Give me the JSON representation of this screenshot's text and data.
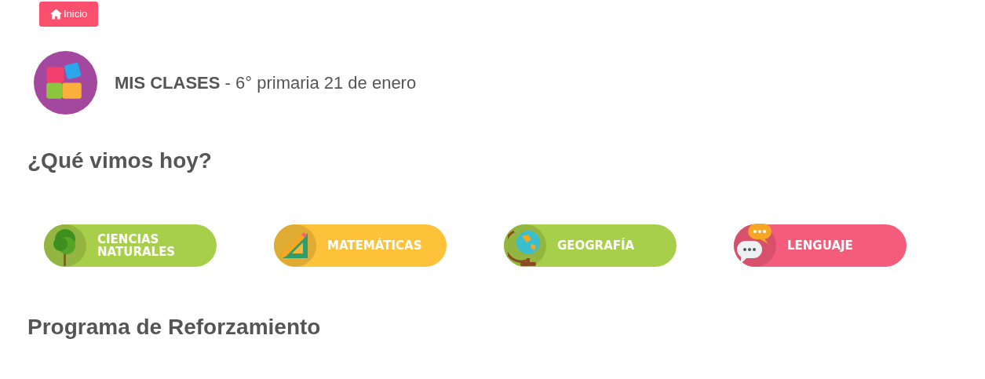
{
  "home_button": {
    "label": "Inicio"
  },
  "header": {
    "title": "MIS CLASES",
    "subtitle": "- 6° primaria 21 de enero"
  },
  "section_today": {
    "title": "¿Qué vimos hoy?"
  },
  "subjects": [
    {
      "kind": "tree",
      "label": "CIENCIAS NATURALES",
      "color": "#a8cf4a"
    },
    {
      "kind": "ruler",
      "label": "MATEMÁTICAS",
      "color": "#fdc239"
    },
    {
      "kind": "globe",
      "label": "GEOGRAFÍA",
      "color": "#a8cf4a"
    },
    {
      "kind": "chat",
      "label": "LENGUAJE",
      "color": "#f45c7c"
    }
  ],
  "section_program": {
    "title": "Programa de Reforzamiento"
  }
}
